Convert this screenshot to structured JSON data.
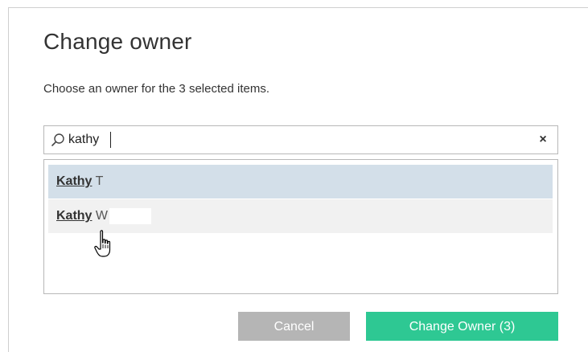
{
  "dialog": {
    "title": "Change owner",
    "subtitle": "Choose an owner for the 3 selected items."
  },
  "search": {
    "value": "kathy",
    "icon": "search-icon",
    "clear_icon": "close-icon",
    "clear_glyph": "×"
  },
  "results": [
    {
      "match": "Kathy",
      "rest": " T",
      "state": "selected"
    },
    {
      "match": "Kathy",
      "rest": " W",
      "state": "hover"
    }
  ],
  "buttons": {
    "cancel_label": "Cancel",
    "primary_label": "Change Owner (3)"
  },
  "colors": {
    "primary": "#2ec893",
    "cancel": "#b5b5b5",
    "selected_row": "#d3dfe9",
    "hover_row": "#f1f1f1"
  }
}
